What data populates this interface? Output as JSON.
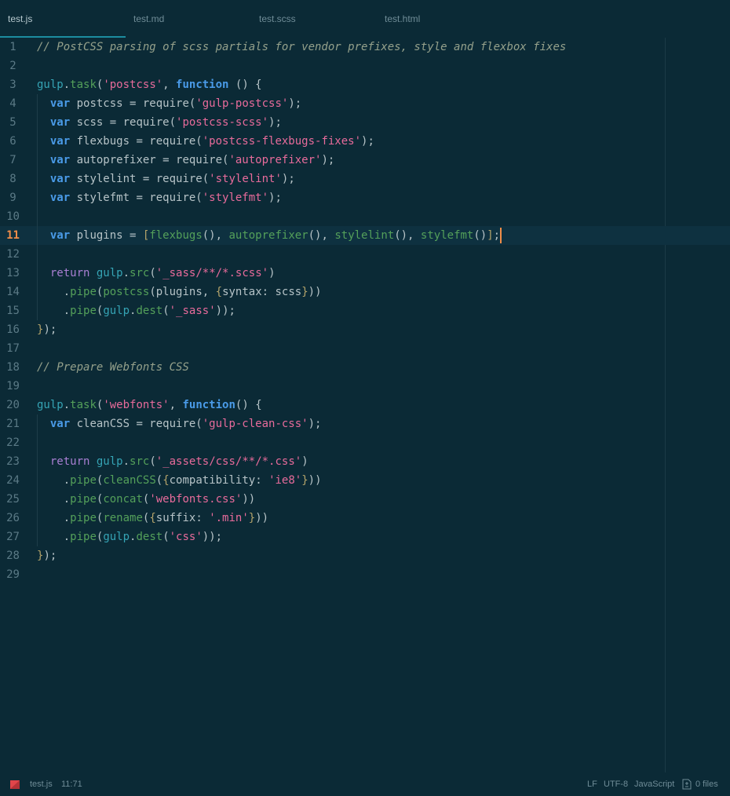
{
  "tabs": [
    {
      "label": "test.js",
      "active": true
    },
    {
      "label": "test.md",
      "active": false
    },
    {
      "label": "test.scss",
      "active": false
    },
    {
      "label": "test.html",
      "active": false
    }
  ],
  "editor": {
    "cursor_line": 11,
    "lines": [
      {
        "n": "1",
        "tokens": [
          [
            "c",
            "// PostCSS parsing of scss partials for vendor prefixes, style and flexbox fixes"
          ]
        ]
      },
      {
        "n": "2",
        "tokens": []
      },
      {
        "n": "3",
        "tokens": [
          [
            "o",
            "gulp"
          ],
          [
            "p",
            "."
          ],
          [
            "m",
            "task"
          ],
          [
            "p",
            "("
          ],
          [
            "s",
            "'postcss'"
          ],
          [
            "p",
            ", "
          ],
          [
            "f",
            "function"
          ],
          [
            "p",
            " () {"
          ]
        ]
      },
      {
        "n": "4",
        "tokens": [
          [
            "p",
            "  "
          ],
          [
            "v",
            "var"
          ],
          [
            "p",
            " postcss = require("
          ],
          [
            "s",
            "'gulp-postcss'"
          ],
          [
            "p",
            ");"
          ]
        ]
      },
      {
        "n": "5",
        "tokens": [
          [
            "p",
            "  "
          ],
          [
            "v",
            "var"
          ],
          [
            "p",
            " scss = require("
          ],
          [
            "s",
            "'postcss-scss'"
          ],
          [
            "p",
            ");"
          ]
        ]
      },
      {
        "n": "6",
        "tokens": [
          [
            "p",
            "  "
          ],
          [
            "v",
            "var"
          ],
          [
            "p",
            " flexbugs = require("
          ],
          [
            "s",
            "'postcss-flexbugs-fixes'"
          ],
          [
            "p",
            ");"
          ]
        ]
      },
      {
        "n": "7",
        "tokens": [
          [
            "p",
            "  "
          ],
          [
            "v",
            "var"
          ],
          [
            "p",
            " autoprefixer = require("
          ],
          [
            "s",
            "'autoprefixer'"
          ],
          [
            "p",
            ");"
          ]
        ]
      },
      {
        "n": "8",
        "tokens": [
          [
            "p",
            "  "
          ],
          [
            "v",
            "var"
          ],
          [
            "p",
            " stylelint = require("
          ],
          [
            "s",
            "'stylelint'"
          ],
          [
            "p",
            ");"
          ]
        ]
      },
      {
        "n": "9",
        "tokens": [
          [
            "p",
            "  "
          ],
          [
            "v",
            "var"
          ],
          [
            "p",
            " stylefmt = require("
          ],
          [
            "s",
            "'stylefmt'"
          ],
          [
            "p",
            ");"
          ]
        ]
      },
      {
        "n": "10",
        "tokens": []
      },
      {
        "n": "11",
        "tokens": [
          [
            "p",
            "  "
          ],
          [
            "v",
            "var"
          ],
          [
            "p",
            " plugins = "
          ],
          [
            "b",
            "["
          ],
          [
            "m",
            "flexbugs"
          ],
          [
            "p",
            "(), "
          ],
          [
            "m",
            "autoprefixer"
          ],
          [
            "p",
            "(), "
          ],
          [
            "m",
            "stylelint"
          ],
          [
            "p",
            "(), "
          ],
          [
            "m",
            "stylefmt"
          ],
          [
            "p",
            "()"
          ],
          [
            "b",
            "]"
          ],
          [
            "p",
            ";"
          ]
        ]
      },
      {
        "n": "12",
        "tokens": []
      },
      {
        "n": "13",
        "tokens": [
          [
            "p",
            "  "
          ],
          [
            "r",
            "return"
          ],
          [
            "p",
            " "
          ],
          [
            "o",
            "gulp"
          ],
          [
            "p",
            "."
          ],
          [
            "m",
            "src"
          ],
          [
            "p",
            "("
          ],
          [
            "s",
            "'_sass/**/*.scss'"
          ],
          [
            "p",
            ")"
          ]
        ]
      },
      {
        "n": "14",
        "tokens": [
          [
            "p",
            "    ."
          ],
          [
            "m",
            "pipe"
          ],
          [
            "p",
            "("
          ],
          [
            "m",
            "postcss"
          ],
          [
            "p",
            "(plugins, "
          ],
          [
            "b",
            "{"
          ],
          [
            "p",
            "syntax: scss"
          ],
          [
            "b",
            "}"
          ],
          [
            "p",
            "))"
          ]
        ]
      },
      {
        "n": "15",
        "tokens": [
          [
            "p",
            "    ."
          ],
          [
            "m",
            "pipe"
          ],
          [
            "p",
            "("
          ],
          [
            "o",
            "gulp"
          ],
          [
            "p",
            "."
          ],
          [
            "m",
            "dest"
          ],
          [
            "p",
            "("
          ],
          [
            "s",
            "'_sass'"
          ],
          [
            "p",
            "));"
          ]
        ]
      },
      {
        "n": "16",
        "tokens": [
          [
            "b",
            "}"
          ],
          [
            "p",
            ");"
          ]
        ]
      },
      {
        "n": "17",
        "tokens": []
      },
      {
        "n": "18",
        "tokens": [
          [
            "c",
            "// Prepare Webfonts CSS"
          ]
        ]
      },
      {
        "n": "19",
        "tokens": []
      },
      {
        "n": "20",
        "tokens": [
          [
            "o",
            "gulp"
          ],
          [
            "p",
            "."
          ],
          [
            "m",
            "task"
          ],
          [
            "p",
            "("
          ],
          [
            "s",
            "'webfonts'"
          ],
          [
            "p",
            ", "
          ],
          [
            "f",
            "function"
          ],
          [
            "p",
            "() {"
          ]
        ]
      },
      {
        "n": "21",
        "tokens": [
          [
            "p",
            "  "
          ],
          [
            "v",
            "var"
          ],
          [
            "p",
            " cleanCSS = require("
          ],
          [
            "s",
            "'gulp-clean-css'"
          ],
          [
            "p",
            ");"
          ]
        ]
      },
      {
        "n": "22",
        "tokens": []
      },
      {
        "n": "23",
        "tokens": [
          [
            "p",
            "  "
          ],
          [
            "r",
            "return"
          ],
          [
            "p",
            " "
          ],
          [
            "o",
            "gulp"
          ],
          [
            "p",
            "."
          ],
          [
            "m",
            "src"
          ],
          [
            "p",
            "("
          ],
          [
            "s",
            "'_assets/css/**/*.css'"
          ],
          [
            "p",
            ")"
          ]
        ]
      },
      {
        "n": "24",
        "tokens": [
          [
            "p",
            "    ."
          ],
          [
            "m",
            "pipe"
          ],
          [
            "p",
            "("
          ],
          [
            "m",
            "cleanCSS"
          ],
          [
            "p",
            "("
          ],
          [
            "b",
            "{"
          ],
          [
            "p",
            "compatibility: "
          ],
          [
            "s",
            "'ie8'"
          ],
          [
            "b",
            "}"
          ],
          [
            "p",
            "))"
          ]
        ]
      },
      {
        "n": "25",
        "tokens": [
          [
            "p",
            "    ."
          ],
          [
            "m",
            "pipe"
          ],
          [
            "p",
            "("
          ],
          [
            "m",
            "concat"
          ],
          [
            "p",
            "("
          ],
          [
            "s",
            "'webfonts.css'"
          ],
          [
            "p",
            "))"
          ]
        ]
      },
      {
        "n": "26",
        "tokens": [
          [
            "p",
            "    ."
          ],
          [
            "m",
            "pipe"
          ],
          [
            "p",
            "("
          ],
          [
            "m",
            "rename"
          ],
          [
            "p",
            "("
          ],
          [
            "b",
            "{"
          ],
          [
            "p",
            "suffix: "
          ],
          [
            "s",
            "'.min'"
          ],
          [
            "b",
            "}"
          ],
          [
            "p",
            "))"
          ]
        ]
      },
      {
        "n": "27",
        "tokens": [
          [
            "p",
            "    ."
          ],
          [
            "m",
            "pipe"
          ],
          [
            "p",
            "("
          ],
          [
            "o",
            "gulp"
          ],
          [
            "p",
            "."
          ],
          [
            "m",
            "dest"
          ],
          [
            "p",
            "("
          ],
          [
            "s",
            "'css'"
          ],
          [
            "p",
            "));"
          ]
        ]
      },
      {
        "n": "28",
        "tokens": [
          [
            "b",
            "}"
          ],
          [
            "p",
            ");"
          ]
        ]
      },
      {
        "n": "29",
        "tokens": []
      }
    ]
  },
  "statusbar": {
    "flag_icon": "bookmark-flag-icon",
    "file": "test.js",
    "position": "11:71",
    "line_ending": "LF",
    "encoding": "UTF-8",
    "grammar": "JavaScript",
    "files_icon": "file-diff-icon",
    "files_count": "0 files"
  },
  "colors": {
    "background": "#0b2a36",
    "accent": "#1c8da0",
    "cursor": "#f08d49",
    "string": "#e86b9b",
    "keyword": "#4a9be8",
    "method": "#54a05a",
    "comment": "#94a08b"
  }
}
